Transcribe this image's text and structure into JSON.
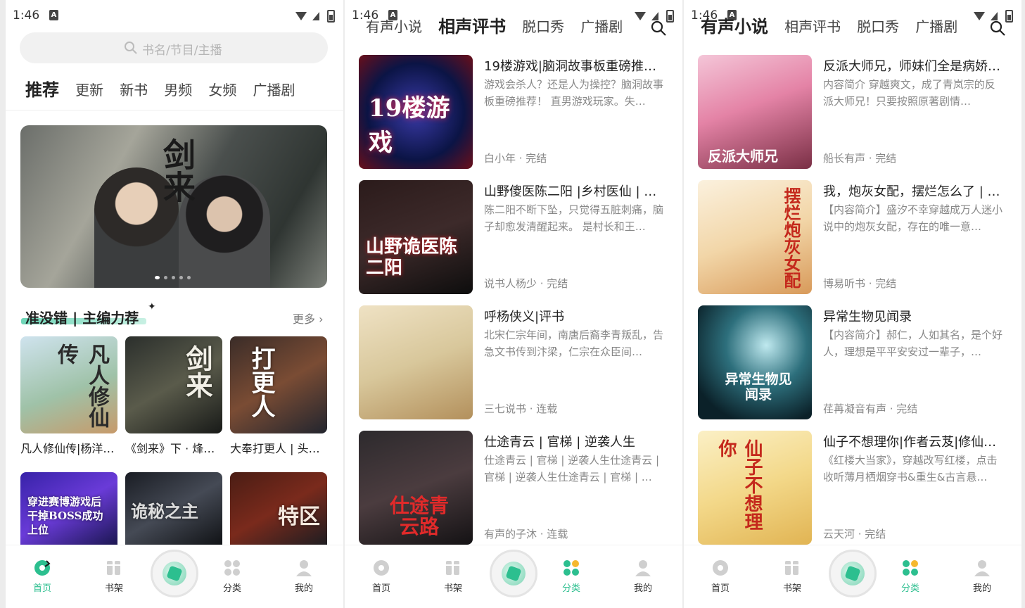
{
  "status": {
    "time": "1:46"
  },
  "panel1": {
    "search_placeholder": "书名/节目/主播",
    "tabs": [
      "推荐",
      "更新",
      "新书",
      "男频",
      "女频",
      "广播剧"
    ],
    "banner_calligraphy": "剑来",
    "section_title": "准没错 | 主编力荐",
    "more_label": "更多 ›",
    "cards": [
      {
        "title": "凡人修仙传|杨洋…",
        "cover_text": "凡人修仙传"
      },
      {
        "title": "《剑来》下 · 烽…",
        "cover_text": "剑来"
      },
      {
        "title": "大奉打更人 | 头…",
        "cover_text": "打更人"
      },
      {
        "title": "",
        "cover_text": "穿进赛博游戏后 干掉BOSS成功上位"
      },
      {
        "title": "",
        "cover_text": "诡秘之主"
      },
      {
        "title": "",
        "cover_text": "特区"
      }
    ]
  },
  "panel2": {
    "tabs": [
      "有声小说",
      "相声评书",
      "脱口秀",
      "广播剧"
    ],
    "items": [
      {
        "title": "19楼游戏|脑洞故事板重磅推…",
        "desc": "游戏会杀人？还是人为操控？脑洞故事板重磅推荐！ 直男游戏玩家。失…",
        "meta": "白小年 · 完结",
        "cover_text": "19楼游戏"
      },
      {
        "title": "山野傻医陈二阳 |乡村医仙 | 【…",
        "desc": "陈二阳不断下坠，只觉得五脏刺痛，脑子却愈发清醒起来。 是村长和王…",
        "meta": "说书人杨少 · 完结",
        "cover_text": "山野诡医陈二阳"
      },
      {
        "title": "呼杨侠义|评书",
        "desc": "北宋仁宗年间，南唐后裔李青叛乱，告急文书传到汴梁，仁宗在众臣间…",
        "meta": "三七说书 · 连载",
        "cover_text": ""
      },
      {
        "title": "仕途青云 | 官梯 | 逆袭人生",
        "desc": "仕途青云 | 官梯 | 逆袭人生仕途青云 | 官梯 | 逆袭人生仕途青云 | 官梯 | …",
        "meta": "有声的子沐 · 连载",
        "cover_text": "仕途青云路"
      }
    ]
  },
  "panel3": {
    "tabs": [
      "有声小说",
      "相声评书",
      "脱口秀",
      "广播剧"
    ],
    "items": [
      {
        "title": "反派大师兄，师妹们全是病娇…",
        "desc": "内容简介 穿越爽文，成了青岚宗的反派大师兄！只要按照原著剧情…",
        "meta": "船长有声 · 完结",
        "cover_text": "反派大师兄"
      },
      {
        "title": "我，炮灰女配，摆烂怎么了 | …",
        "desc": "【内容简介】盛汐不幸穿越成万人迷小说中的炮灰女配，存在的唯一意…",
        "meta": "博易听书 · 完结",
        "cover_text": "摆烂炮灰女配"
      },
      {
        "title": "异常生物见闻录",
        "desc": "【内容简介】郝仁，人如其名，是个好人，理想是平平安安过一辈子，…",
        "meta": "荏苒凝音有声 · 完结",
        "cover_text": "异常生物见闻录"
      },
      {
        "title": "仙子不想理你|作者云芨|修仙…",
        "desc": "《红楼大当家》，穿越改写红楼，点击收听薄月栖烟穿书&重生&古言悬…",
        "meta": "云天河 · 完结",
        "cover_text": "仙子不想理你"
      }
    ]
  },
  "nav": {
    "items": [
      "首页",
      "书架",
      "分类",
      "我的"
    ]
  },
  "colors": {
    "accent": "#2cbf8f"
  }
}
